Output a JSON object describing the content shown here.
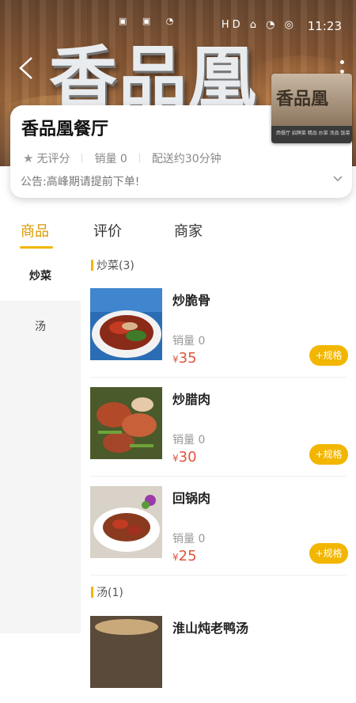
{
  "status_bar": {
    "time": "11:23",
    "icons": "HD ⌂ ◔ ◎"
  },
  "banner": {
    "sign_text": "香品凰"
  },
  "shop": {
    "name": "香品凰餐厅",
    "rating": "无评分",
    "sales": "销量 0",
    "delivery": "配送约30分钟",
    "notice": "公告:高峰期请提前下单!",
    "logo_text": "香品凰",
    "logo_subtext": "西餐厅 招牌菜 精品 炒菜 汤品 饭菜"
  },
  "tabs": [
    {
      "label": "商品",
      "active": true
    },
    {
      "label": "评价",
      "active": false
    },
    {
      "label": "商家",
      "active": false
    }
  ],
  "sidebar": [
    {
      "label": "炒菜",
      "active": true
    },
    {
      "label": "汤",
      "active": false
    }
  ],
  "categories": [
    {
      "title": "炒菜(3)"
    },
    {
      "title": "汤(1)"
    }
  ],
  "items": [
    {
      "name": "炒脆骨",
      "sales": "销量 0",
      "currency": "¥",
      "price": "35",
      "button": "+规格"
    },
    {
      "name": "炒腊肉",
      "sales": "销量 0",
      "currency": "¥",
      "price": "30",
      "button": "+规格"
    },
    {
      "name": "回锅肉",
      "sales": "销量 0",
      "currency": "¥",
      "price": "25",
      "button": "+规格"
    },
    {
      "name": "淮山炖老鸭汤",
      "sales": "",
      "currency": "",
      "price": "",
      "button": ""
    }
  ],
  "colors": {
    "accent": "#f2b600",
    "price": "#e0543c",
    "active_tab": "#d99b00"
  }
}
